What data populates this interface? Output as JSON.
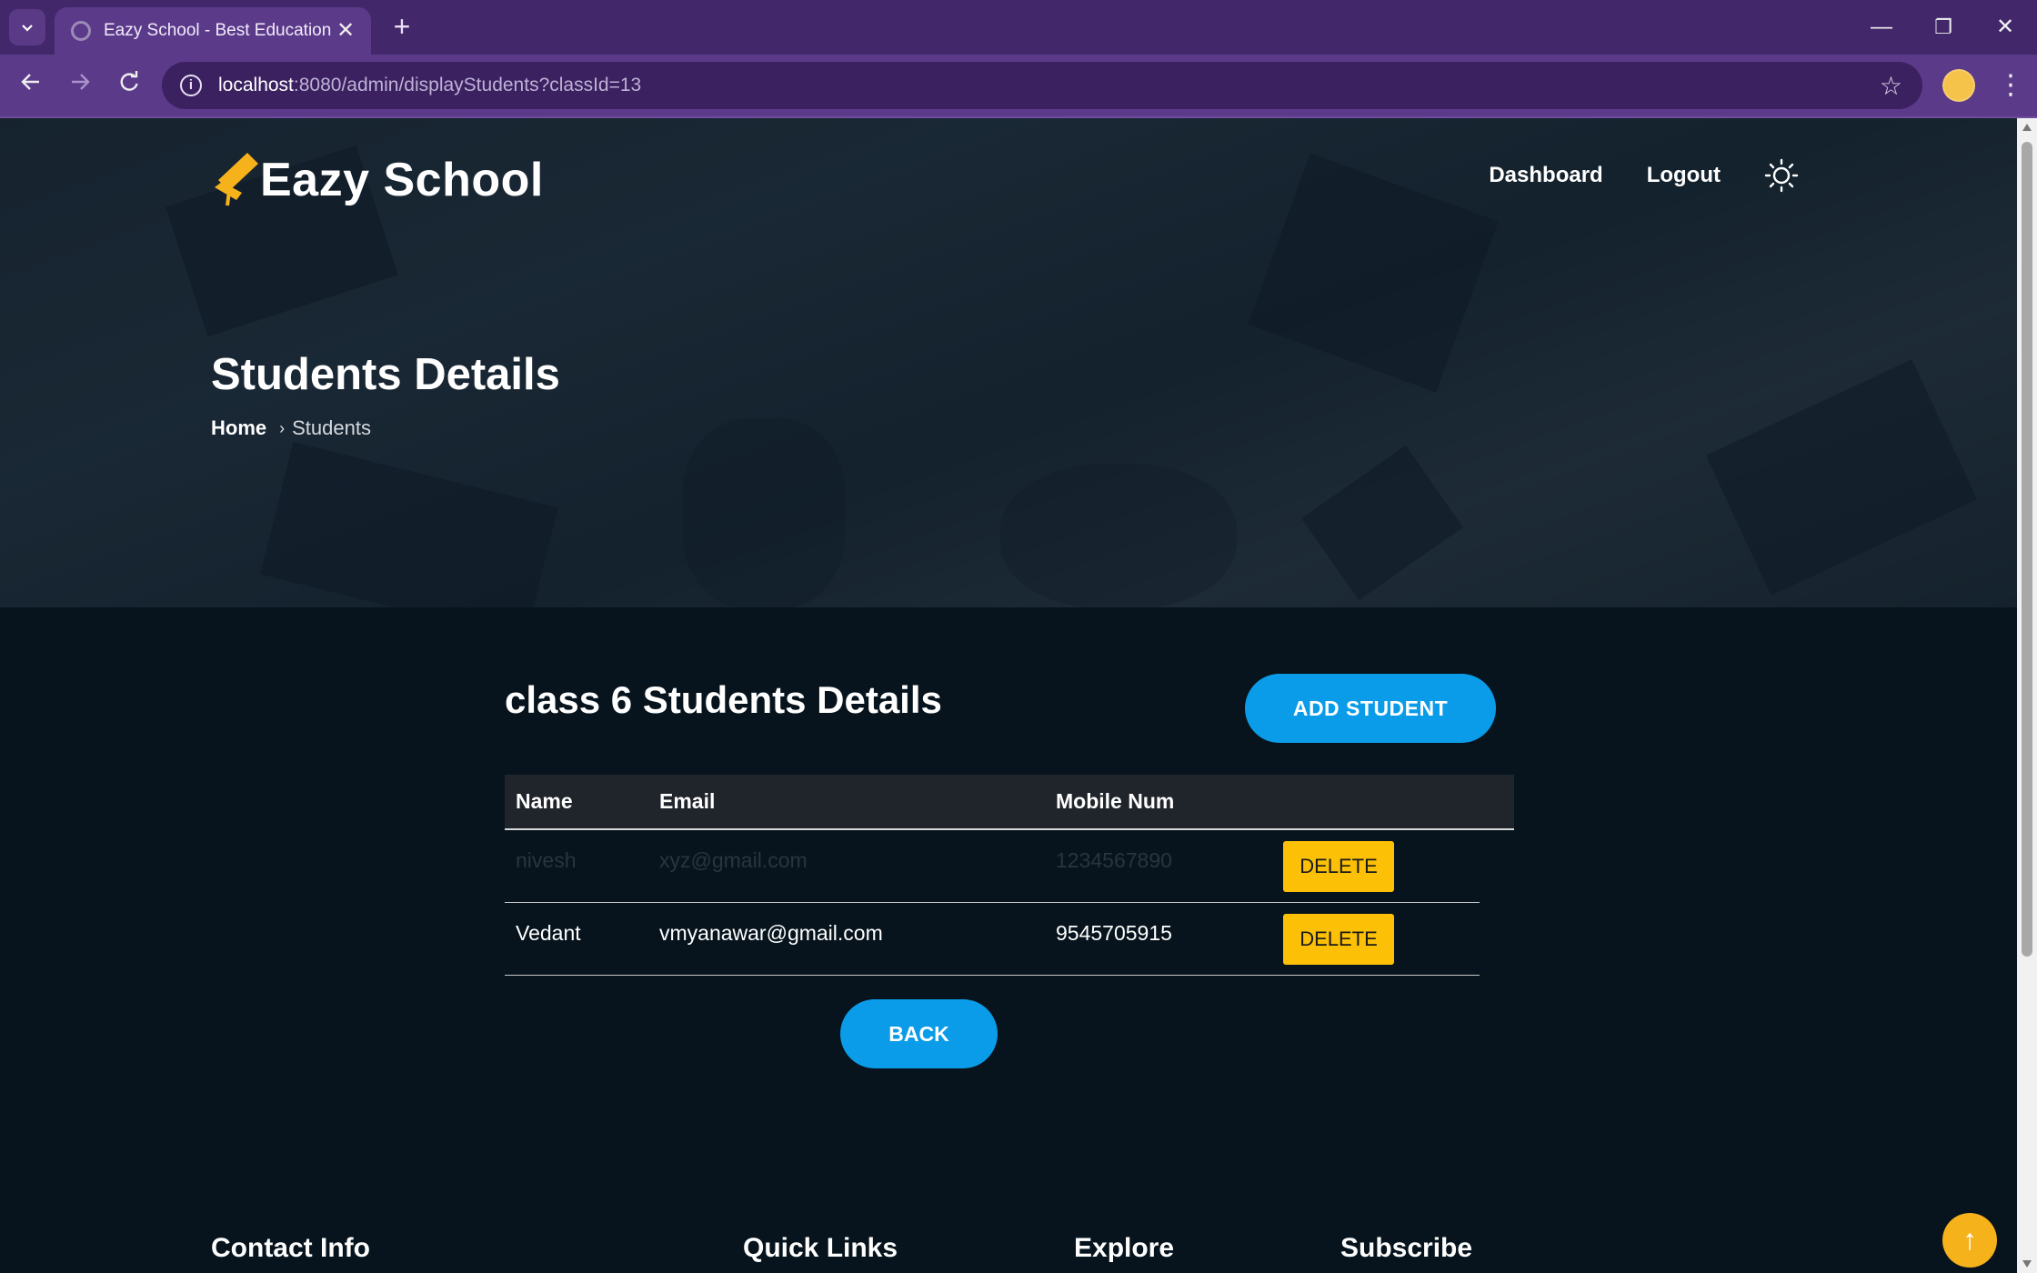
{
  "browser": {
    "tab_title": "Eazy School - Best Educational Institute",
    "tab_close": "✕",
    "new_tab": "+",
    "url_host": "localhost",
    "url_rest": ":8080/admin/displayStudents?classId=13",
    "window_controls": {
      "minimize": "—",
      "restore": "❐",
      "close": "✕"
    }
  },
  "header": {
    "logo_text": "Eazy School",
    "nav": {
      "dashboard": "Dashboard",
      "logout": "Logout"
    }
  },
  "hero": {
    "title": "Students Details",
    "breadcrumb": {
      "home": "Home",
      "separator": "›",
      "current": "Students"
    }
  },
  "main": {
    "section_title": "class 6 Students Details",
    "add_button": "ADD STUDENT",
    "table": {
      "headers": [
        "Name",
        "Email",
        "Mobile Num"
      ],
      "rows": [
        {
          "name": "nivesh",
          "email": "xyz@gmail.com",
          "mobile": "1234567890",
          "action": "DELETE"
        },
        {
          "name": "Vedant",
          "email": "vmyanawar@gmail.com",
          "mobile": "9545705915",
          "action": "DELETE"
        }
      ]
    },
    "back_button": "BACK"
  },
  "footer": {
    "headings": [
      "Contact Info",
      "Quick Links",
      "Explore",
      "Subscribe"
    ]
  },
  "colors": {
    "brand_purple": "#4a2a73",
    "primary_button": "#0a9ce8",
    "delete_button": "#fcc107",
    "scroll_top": "#f6b21b"
  },
  "icons": {
    "to_top": "↑"
  }
}
